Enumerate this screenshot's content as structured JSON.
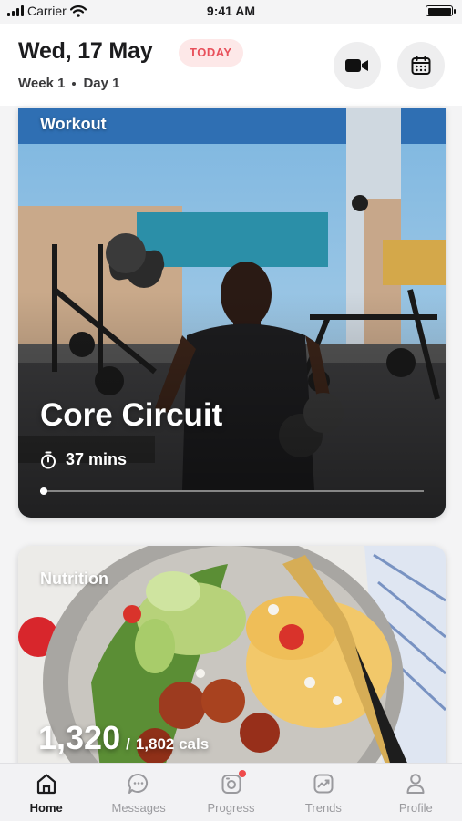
{
  "status_bar": {
    "carrier": "Carrier",
    "time": "9:41 AM"
  },
  "header": {
    "date": "Wed, 17 May",
    "today_badge": "TODAY",
    "week": "Week 1",
    "day": "Day 1",
    "video_button_icon": "video-camera-icon",
    "calendar_button_icon": "calendar-icon"
  },
  "workout_card": {
    "label": "Workout",
    "title": "Core Circuit",
    "duration": "37 mins",
    "duration_icon": "stopwatch-icon",
    "progress": 0.01
  },
  "nutrition_card": {
    "label": "Nutrition",
    "calories_consumed": "1,320",
    "separator": "/",
    "calories_goal": "1,802 cals"
  },
  "tab_bar": {
    "tabs": [
      {
        "label": "Home",
        "icon": "home-icon",
        "active": true
      },
      {
        "label": "Messages",
        "icon": "chat-bubble-icon",
        "active": false
      },
      {
        "label": "Progress",
        "icon": "camera-progress-icon",
        "active": false,
        "badge": true
      },
      {
        "label": "Trends",
        "icon": "trend-chart-icon",
        "active": false
      },
      {
        "label": "Profile",
        "icon": "person-icon",
        "active": false
      }
    ]
  },
  "colors": {
    "accent": "#e8505b",
    "badge_bg": "#fde8e8",
    "notification": "#ef4b4b",
    "active_tab": "#1c1c1e",
    "inactive_tab": "#9a9a9e"
  }
}
